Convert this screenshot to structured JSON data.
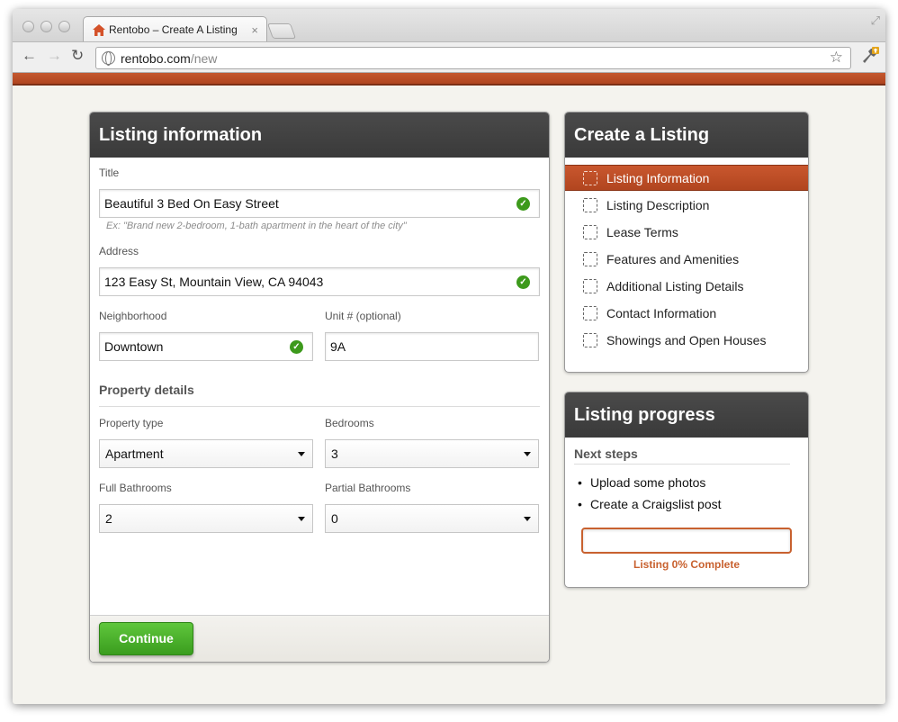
{
  "browser": {
    "tab_title": "Rentobo – Create A Listing",
    "tab_close": "×",
    "url_host": "rentobo.com",
    "url_path": "/new",
    "icons": [
      "back-icon",
      "forward-icon",
      "reload-icon",
      "globe-icon",
      "star-icon",
      "wrench-icon",
      "fullscreen-icon"
    ]
  },
  "listing_form": {
    "header": "Listing information",
    "title_label": "Title",
    "title_value": "Beautiful 3 Bed On Easy Street",
    "title_hint": "Ex: \"Brand new 2-bedroom, 1-bath apartment in the heart of the city\"",
    "address_label": "Address",
    "address_value": "123 Easy St, Mountain View, CA 94043",
    "neighborhood_label": "Neighborhood",
    "neighborhood_value": "Downtown",
    "unit_label": "Unit # (optional)",
    "unit_value": "9A",
    "property_details_title": "Property details",
    "property_type_label": "Property type",
    "property_type_value": "Apartment",
    "bedrooms_label": "Bedrooms",
    "bedrooms_value": "3",
    "full_bathrooms_label": "Full Bathrooms",
    "full_bathrooms_value": "2",
    "partial_bathrooms_label": "Partial Bathrooms",
    "partial_bathrooms_value": "0",
    "continue_label": "Continue"
  },
  "create_listing": {
    "header": "Create a Listing",
    "steps": [
      {
        "label": "Listing Information",
        "active": true
      },
      {
        "label": "Listing Description",
        "active": false
      },
      {
        "label": "Lease Terms",
        "active": false
      },
      {
        "label": "Features and Amenities",
        "active": false
      },
      {
        "label": "Additional Listing Details",
        "active": false
      },
      {
        "label": "Contact Information",
        "active": false
      },
      {
        "label": "Showings and Open Houses",
        "active": false
      }
    ]
  },
  "listing_progress": {
    "header": "Listing progress",
    "next_steps_title": "Next steps",
    "next_steps": [
      "Upload some photos",
      "Create a Craigslist post"
    ],
    "percent_complete": 0,
    "progress_text": "Listing 0% Complete"
  },
  "colors": {
    "brand_orange": "#c8612f",
    "header_dark": "#3f3f3f",
    "success_green": "#3d9a1c",
    "button_green": "#4cb02b"
  }
}
